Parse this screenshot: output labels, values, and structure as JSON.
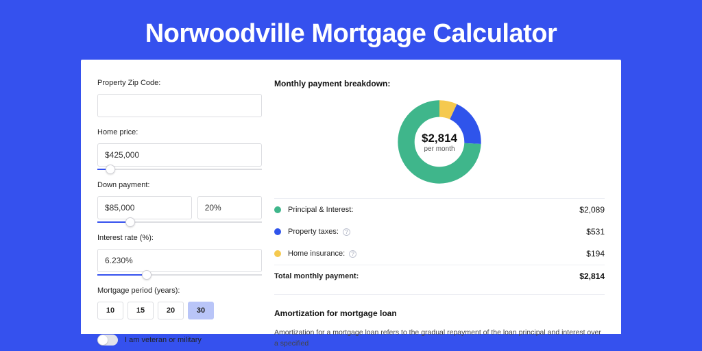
{
  "title": "Norwoodville Mortgage Calculator",
  "form": {
    "zip_label": "Property Zip Code:",
    "zip_value": "",
    "home_price_label": "Home price:",
    "home_price_value": "$425,000",
    "home_price_slider_pct": 8,
    "down_payment_label": "Down payment:",
    "down_payment_value": "$85,000",
    "down_payment_pct_value": "20%",
    "down_payment_slider_pct": 20,
    "interest_label": "Interest rate (%):",
    "interest_value": "6.230%",
    "interest_slider_pct": 30,
    "period_label": "Mortgage period (years):",
    "periods": [
      "10",
      "15",
      "20",
      "30"
    ],
    "period_active_index": 3,
    "veteran_label": "I am veteran or military"
  },
  "breakdown": {
    "title": "Monthly payment breakdown:",
    "center_amount": "$2,814",
    "center_sub": "per month",
    "items": [
      {
        "label": "Principal & Interest:",
        "value": "$2,089",
        "color": "#3fb68b",
        "info": false
      },
      {
        "label": "Property taxes:",
        "value": "$531",
        "color": "#2f54eb",
        "info": true
      },
      {
        "label": "Home insurance:",
        "value": "$194",
        "color": "#f5c94e",
        "info": true
      }
    ],
    "total_label": "Total monthly payment:",
    "total_value": "$2,814"
  },
  "chart_data": {
    "type": "pie",
    "title": "Monthly payment breakdown",
    "series": [
      {
        "name": "Principal & Interest",
        "value": 2089,
        "color": "#3fb68b"
      },
      {
        "name": "Property taxes",
        "value": 531,
        "color": "#2f54eb"
      },
      {
        "name": "Home insurance",
        "value": 194,
        "color": "#f5c94e"
      }
    ],
    "total": 2814,
    "center_label": "$2,814 per month"
  },
  "amort": {
    "title": "Amortization for mortgage loan",
    "body": "Amortization for a mortgage loan refers to the gradual repayment of the loan principal and interest over a specified"
  }
}
